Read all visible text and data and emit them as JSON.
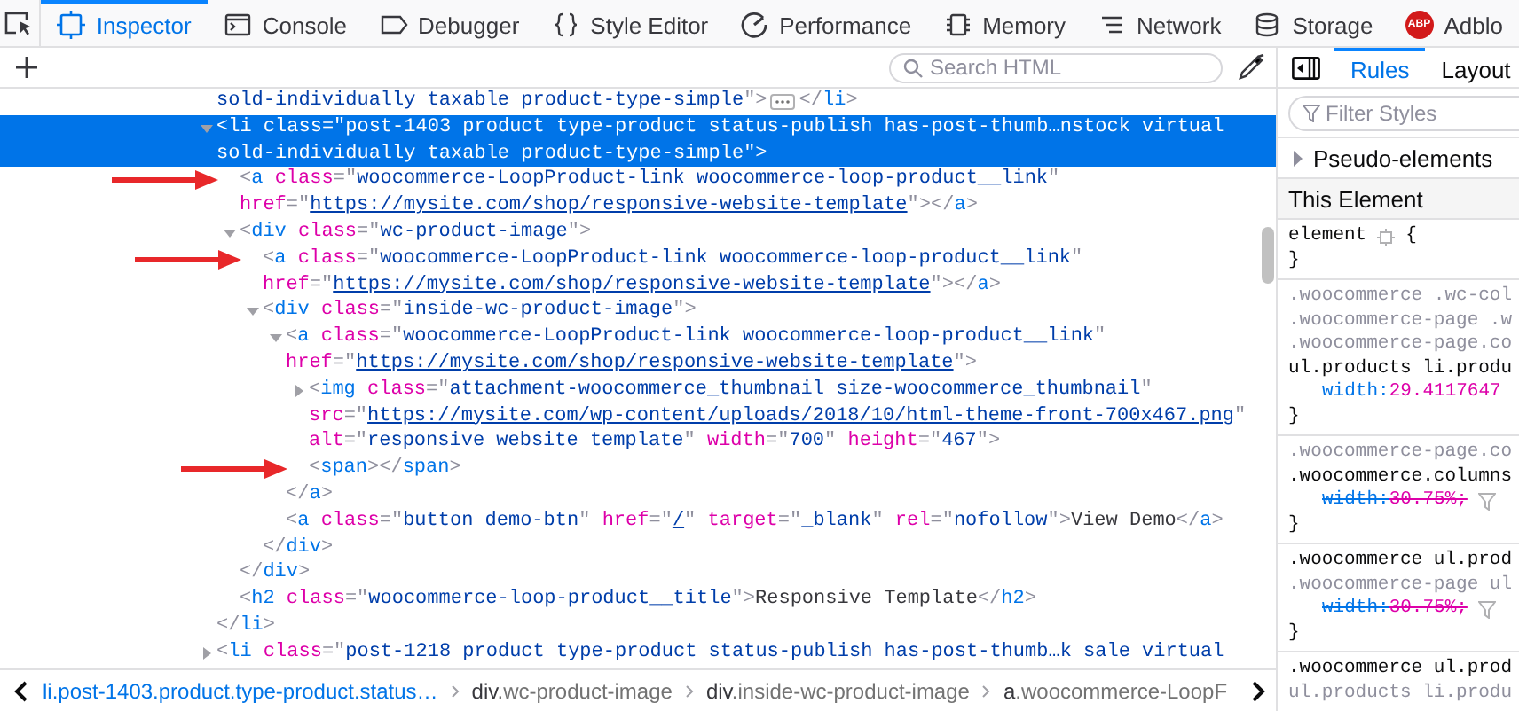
{
  "toolbox": {
    "tabs": [
      {
        "label": "Inspector",
        "selected": true
      },
      {
        "label": "Console",
        "selected": false
      },
      {
        "label": "Debugger",
        "selected": false
      },
      {
        "label": "Style Editor",
        "selected": false
      },
      {
        "label": "Performance",
        "selected": false
      },
      {
        "label": "Memory",
        "selected": false
      },
      {
        "label": "Network",
        "selected": false
      },
      {
        "label": "Storage",
        "selected": false
      },
      {
        "label": "Adblo",
        "badge": "ABP",
        "selected": false
      }
    ]
  },
  "markup": {
    "search": {
      "placeholder": "Search HTML"
    },
    "tree": [
      {
        "continued": true,
        "collapsed_badge": true,
        "lines": [
          "sold-individually taxable product-type-simple\">"
        ],
        "close": "</li>"
      },
      {
        "selected": true,
        "expanded": true,
        "lines": [
          "<li class=\"post-1403 product type-product status-publish has-post-thumb…nstock virtual",
          "sold-individually taxable product-type-simple\">"
        ],
        "close": "</li>",
        "children": [
          {
            "annotated": true,
            "lines": [
              "<a class=\"woocommerce-LoopProduct-link woocommerce-loop-product__link\"",
              "href=\"https://mysite.com/shop/responsive-website-template\"></a>"
            ]
          },
          {
            "expanded": true,
            "lines": [
              "<div class=\"wc-product-image\">"
            ],
            "close": "</div>",
            "children": [
              {
                "annotated": true,
                "lines": [
                  "<a class=\"woocommerce-LoopProduct-link woocommerce-loop-product__link\"",
                  "href=\"https://mysite.com/shop/responsive-website-template\"></a>"
                ]
              },
              {
                "expanded": true,
                "lines": [
                  "<div class=\"inside-wc-product-image\">"
                ],
                "close": "</div>",
                "children": [
                  {
                    "expanded": true,
                    "lines": [
                      "<a class=\"woocommerce-LoopProduct-link woocommerce-loop-product__link\"",
                      "href=\"https://mysite.com/shop/responsive-website-template\">"
                    ],
                    "close": "</a>",
                    "children": [
                      {
                        "expanded": false,
                        "lines": [
                          "<img class=\"attachment-woocommerce_thumbnail size-woocommerce_thumbnail\"",
                          "src=\"https://mysite.com/wp-content/uploads/2018/10/html-theme-front-700x467.png\"",
                          "alt=\"responsive website template\" width=\"700\" height=\"467\">"
                        ]
                      },
                      {
                        "annotated": true,
                        "lines": [
                          "<span></span>"
                        ]
                      }
                    ]
                  },
                  {
                    "lines": [
                      "<a class=\"button demo-btn\" href=\"/\" target=\"_blank\" rel=\"nofollow\">View Demo</a>"
                    ]
                  }
                ]
              }
            ]
          },
          {
            "lines": [
              "<h2 class=\"woocommerce-loop-product__title\">Responsive Template</h2>"
            ]
          }
        ]
      },
      {
        "expanded": false,
        "lines": [
          "<li class=\"post-1218 product type-product status-publish has-post-thumb…k sale virtual"
        ]
      }
    ],
    "breadcrumbs": [
      {
        "tag": "li",
        "classes": ".post-1403.product.type-product.status…",
        "selected": true
      },
      {
        "tag": "div",
        "classes": ".wc-product-image",
        "selected": false
      },
      {
        "tag": "div",
        "classes": ".inside-wc-product-image",
        "selected": false
      },
      {
        "tag": "a",
        "classes": ".woocommerce-LoopF",
        "selected": false
      }
    ]
  },
  "rules_panel": {
    "tabs": [
      {
        "label": "Rules",
        "selected": true
      },
      {
        "label": "Layout",
        "selected": false
      }
    ],
    "filter": {
      "placeholder": "Filter Styles"
    },
    "pseudo": {
      "label": "Pseudo-elements",
      "expanded": false
    },
    "section": "This Element",
    "rules": [
      {
        "selectors": [
          {
            "text": "element",
            "matched": true
          }
        ],
        "gear": true,
        "open": "{",
        "close": "}"
      },
      {
        "selectors": [
          {
            "text": ".woocommerce .wc-col",
            "matched": false
          },
          {
            "text": ".woocommerce-page .w",
            "matched": false
          },
          {
            "text": ".woocommerce-page.co",
            "matched": false
          },
          {
            "text": "ul.products li.produ",
            "matched": true
          }
        ],
        "declarations": [
          {
            "property": "width:",
            "value": "29.4117647",
            "overridden": false,
            "filter_icon": false
          }
        ],
        "close": "}"
      },
      {
        "selectors": [
          {
            "text": ".woocommerce-page.co",
            "matched": false
          },
          {
            "text": ".woocommerce.columns",
            "matched": true
          }
        ],
        "declarations": [
          {
            "property": "width:",
            "value": "30.75%;",
            "overridden": true,
            "filter_icon": true
          }
        ],
        "close": "}"
      },
      {
        "selectors": [
          {
            "text": ".woocommerce ul.prod",
            "matched": true
          },
          {
            "text": ".woocommerce-page ul",
            "matched": false
          }
        ],
        "declarations": [
          {
            "property": "width:",
            "value": "30.75%;",
            "overridden": true,
            "filter_icon": true
          }
        ],
        "close": "}"
      },
      {
        "selectors": [
          {
            "text": ".woocommerce ul.prod",
            "matched": true
          },
          {
            "text": "ul.products li.produ",
            "matched": false
          }
        ]
      }
    ]
  }
}
